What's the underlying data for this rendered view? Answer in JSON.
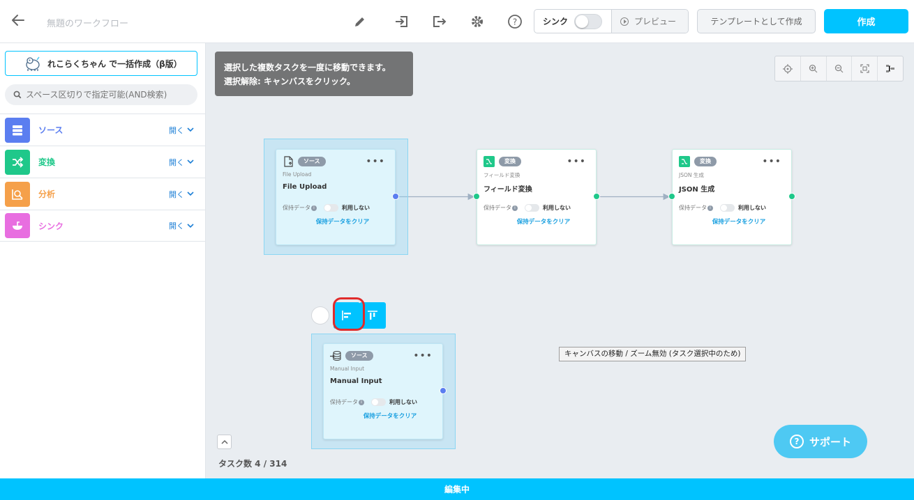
{
  "header": {
    "workflow_title": "無題のワークフロー",
    "sync_label": "シンク",
    "preview_label": "プレビュー",
    "template_button": "テンプレートとして作成",
    "create_button": "作成"
  },
  "sidebar": {
    "bulk_create_label": "れこらくちゃん で一括作成（β版）",
    "search_placeholder": "スペース区切りで指定可能(AND検索)",
    "categories": [
      {
        "label": "ソース",
        "open": "開く",
        "color": "#5b7ef0"
      },
      {
        "label": "変換",
        "open": "開く",
        "color": "#1fc88a"
      },
      {
        "label": "分析",
        "open": "開く",
        "color": "#f5a04a"
      },
      {
        "label": "シンク",
        "open": "開く",
        "color": "#e86ee0"
      }
    ]
  },
  "canvas": {
    "tip_line1": "選択した複数タスクを一度に移動できます。",
    "tip_line2": "選択解除: キャンバスをクリック。",
    "tooltip": "キャンバスの移動 / ズーム無効 (タスク選択中のため)",
    "task_count": "タスク数 4 / 314",
    "support_label": "サポート",
    "nodes": [
      {
        "tag": "ソース",
        "sub": "File Upload",
        "name": "File Upload",
        "keep_label": "保持データ",
        "toggle_label": "利用しない",
        "clear_label": "保持データをクリア",
        "selected": true
      },
      {
        "tag": "変換",
        "sub": "フィールド変換",
        "name": "フィールド変換",
        "keep_label": "保持データ",
        "toggle_label": "利用しない",
        "clear_label": "保持データをクリア",
        "selected": false
      },
      {
        "tag": "変換",
        "sub": "JSON 生成",
        "name": "JSON 生成",
        "keep_label": "保持データ",
        "toggle_label": "利用しない",
        "clear_label": "保持データをクリア",
        "selected": false
      },
      {
        "tag": "ソース",
        "sub": "Manual Input",
        "name": "Manual Input",
        "keep_label": "保持データ",
        "toggle_label": "利用しない",
        "clear_label": "保持データをクリア",
        "selected": true
      }
    ]
  },
  "footer": {
    "status": "編集中"
  },
  "colors": {
    "accent": "#00c3ff",
    "tip_bg": "#737475",
    "port_green": "#1fc88a",
    "port_blue": "#5b7ef0",
    "highlight_ring": "#e02b2b"
  }
}
